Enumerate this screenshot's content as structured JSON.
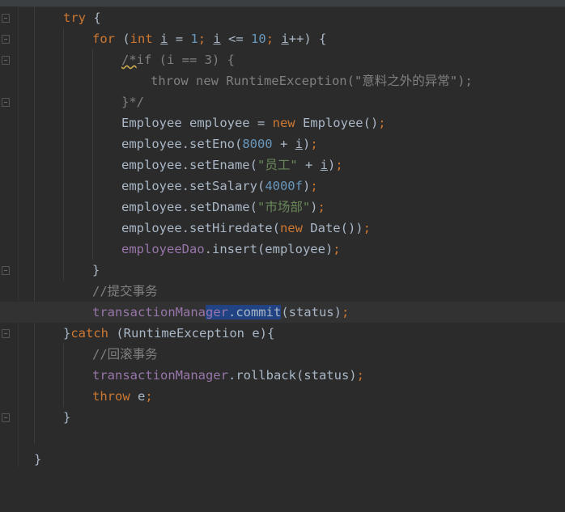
{
  "editor": {
    "language": "Java",
    "theme_colors": {
      "background": "#2b2b2b",
      "keyword": "#cc7832",
      "number": "#6897bb",
      "string": "#6a8759",
      "comment": "#808080",
      "field": "#9876aa",
      "default": "#a9b7c6",
      "selection": "#214283",
      "current_line": "#323232"
    },
    "selected_text": "ger.commit"
  },
  "code": {
    "l1": {
      "kw": "try",
      "rest": " {"
    },
    "l2": {
      "kw_for": "for",
      "p1": " (",
      "kw_int": "int",
      "sp": " ",
      "var1": "i",
      "eq": " = ",
      "n1": "1",
      "semi1": "; ",
      "var2": "i",
      "le": " <= ",
      "n2": "10",
      "semi2": "; ",
      "var3": "i",
      "end": "++) {"
    },
    "l3": {
      "open": "/*",
      "rest": "if (i == 3) {"
    },
    "l4": {
      "text": "throw new RuntimeException(\"意料之外的异常\");"
    },
    "l5": {
      "text": "}*/"
    },
    "l6": {
      "a": "Employee employee = ",
      "kw": "new",
      "b": " Employee()",
      "semi": ";"
    },
    "l7": {
      "a": "employee.setEno(",
      "num": "8000",
      "b": " + ",
      "var": "i",
      "c": ")",
      "semi": ";"
    },
    "l8": {
      "a": "employee.setEname(",
      "str": "\"员工\"",
      "b": " + ",
      "var": "i",
      "c": ")",
      "semi": ";"
    },
    "l9": {
      "a": "employee.setSalary(",
      "num": "4000f",
      "c": ")",
      "semi": ";"
    },
    "l10": {
      "a": "employee.setDname(",
      "str": "\"市场部\"",
      "c": ")",
      "semi": ";"
    },
    "l11": {
      "a": "employee.setHiredate(",
      "kw": "new",
      "b": " Date())",
      "semi": ";"
    },
    "l12": {
      "field": "employeeDao",
      "b": ".insert(employee)",
      "semi": ";"
    },
    "l13": {
      "text": "}"
    },
    "l14": {
      "text": "//提交事务"
    },
    "l15": {
      "field1": "transactionMana",
      "field2": "ger",
      "sel_rest": ".commit",
      "b": "(status)",
      "semi": ";"
    },
    "l16": {
      "a": "}",
      "kw": "catch",
      "b": " (RuntimeException e){"
    },
    "l17": {
      "text": "//回滚事务"
    },
    "l18": {
      "field": "transactionManager",
      "b": ".rollback(status)",
      "semi": ";"
    },
    "l19": {
      "kw": "throw",
      "b": " e",
      "semi": ";"
    },
    "l20": {
      "text": "}"
    },
    "l21": {
      "text": ""
    },
    "l22": {
      "text": "}"
    }
  }
}
